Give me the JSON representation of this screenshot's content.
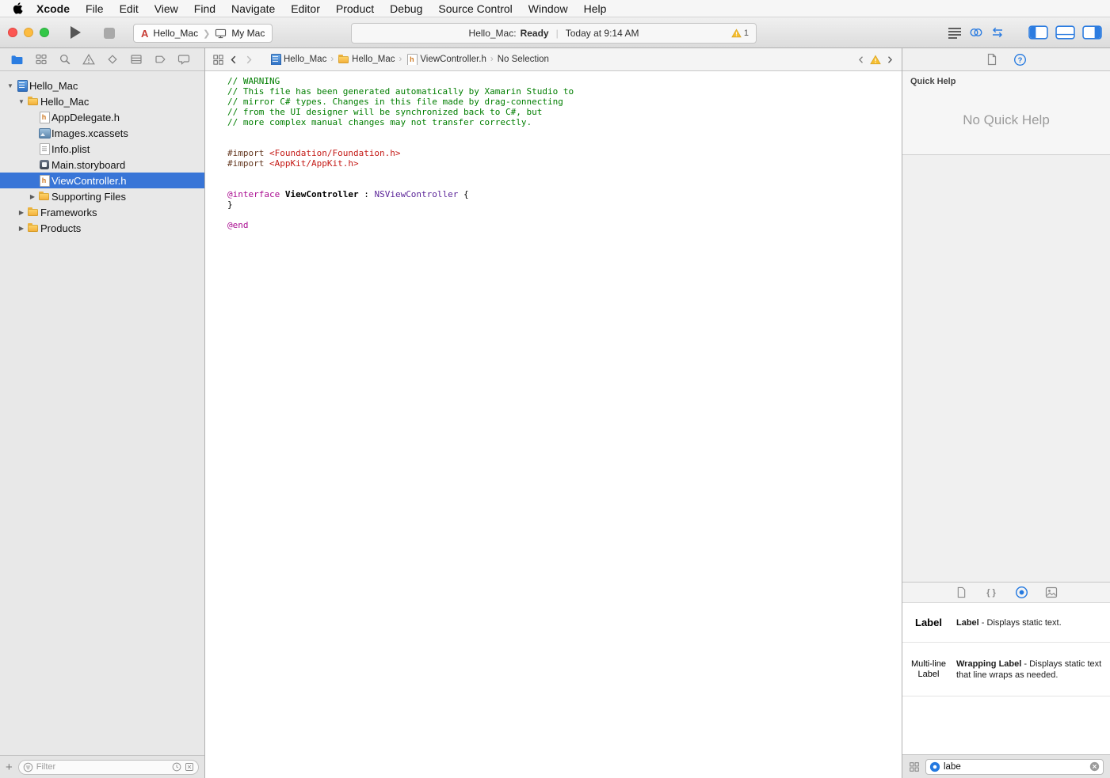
{
  "menubar": {
    "items": [
      "Xcode",
      "File",
      "Edit",
      "View",
      "Find",
      "Navigate",
      "Editor",
      "Product",
      "Debug",
      "Source Control",
      "Window",
      "Help"
    ]
  },
  "toolbar": {
    "scheme_name": "Hello_Mac",
    "target_name": "My Mac",
    "status_project": "Hello_Mac:",
    "status_state": "Ready",
    "status_time": "Today at 9:14 AM",
    "warning_count": "1"
  },
  "navigator": {
    "filter_placeholder": "Filter",
    "tree": [
      {
        "label": "Hello_Mac",
        "icon": "project-doc",
        "level": 0,
        "disclosure": "open"
      },
      {
        "label": "Hello_Mac",
        "icon": "folder",
        "level": 1,
        "disclosure": "open"
      },
      {
        "label": "AppDelegate.h",
        "icon": "page-h",
        "level": 2
      },
      {
        "label": "Images.xcassets",
        "icon": "assets",
        "level": 2
      },
      {
        "label": "Info.plist",
        "icon": "plist",
        "level": 2
      },
      {
        "label": "Main.storyboard",
        "icon": "storyboard",
        "level": 2
      },
      {
        "label": "ViewController.h",
        "icon": "page-h",
        "level": 2,
        "selected": true
      },
      {
        "label": "Supporting Files",
        "icon": "folder",
        "level": 2,
        "disclosure": "closed"
      },
      {
        "label": "Frameworks",
        "icon": "folder",
        "level": 1,
        "disclosure": "closed"
      },
      {
        "label": "Products",
        "icon": "folder",
        "level": 1,
        "disclosure": "closed"
      }
    ]
  },
  "editor": {
    "breadcrumb": [
      {
        "label": "Hello_Mac",
        "icon": "project-doc"
      },
      {
        "label": "Hello_Mac",
        "icon": "folder"
      },
      {
        "label": "ViewController.h",
        "icon": "page-h"
      },
      {
        "label": "No Selection",
        "icon": ""
      }
    ],
    "code": [
      [
        {
          "t": "// WARNING",
          "c": "comment"
        }
      ],
      [
        {
          "t": "// This file has been generated automatically by Xamarin Studio to",
          "c": "comment"
        }
      ],
      [
        {
          "t": "// mirror C# types. Changes in this file made by drag-connecting",
          "c": "comment"
        }
      ],
      [
        {
          "t": "// from the UI designer will be synchronized back to C#, but",
          "c": "comment"
        }
      ],
      [
        {
          "t": "// more complex manual changes may not transfer correctly.",
          "c": "comment"
        }
      ],
      [],
      [],
      [
        {
          "t": "#import ",
          "c": "prep"
        },
        {
          "t": "<Foundation/Foundation.h>",
          "c": "string"
        }
      ],
      [
        {
          "t": "#import ",
          "c": "prep"
        },
        {
          "t": "<AppKit/AppKit.h>",
          "c": "string"
        }
      ],
      [],
      [],
      [
        {
          "t": "@interface",
          "c": "keyword"
        },
        {
          "t": " ",
          "c": "plain"
        },
        {
          "t": "ViewController",
          "c": "decl"
        },
        {
          "t": " : ",
          "c": "plain"
        },
        {
          "t": "NSViewController",
          "c": "classname"
        },
        {
          "t": " {",
          "c": "plain"
        }
      ],
      [
        {
          "t": "}",
          "c": "plain"
        }
      ],
      [],
      [
        {
          "t": "@end",
          "c": "keyword"
        }
      ]
    ]
  },
  "utilities": {
    "quick_help_title": "Quick Help",
    "quick_help_empty": "No Quick Help",
    "library": {
      "items": [
        {
          "preview": "Label",
          "title": "Label",
          "desc": " - Displays static text."
        },
        {
          "preview": "Multi-line Label",
          "title": "Wrapping Label",
          "desc": " - Displays static text that line wraps as needed."
        }
      ],
      "search_value": "labe"
    }
  }
}
